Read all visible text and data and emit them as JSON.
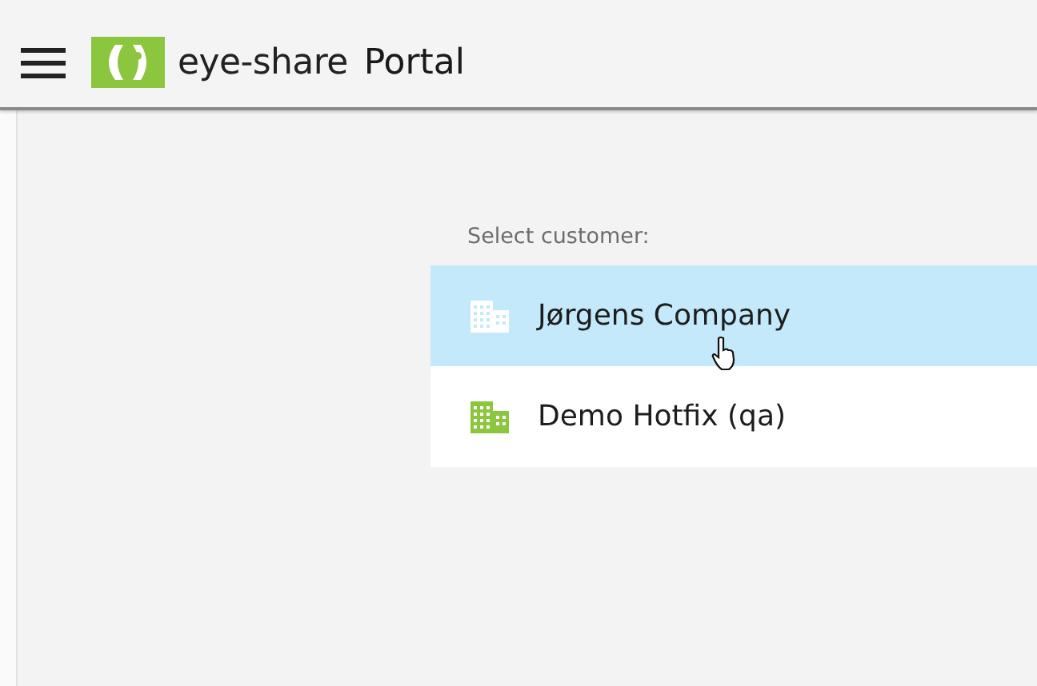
{
  "header": {
    "brand": "eye-share",
    "title": "Portal"
  },
  "customer_list": {
    "label": "Select customer:",
    "items": [
      {
        "name": "Jørgens Company",
        "selected": true
      },
      {
        "name": "Demo Hotfix (qa)",
        "selected": false
      }
    ]
  }
}
